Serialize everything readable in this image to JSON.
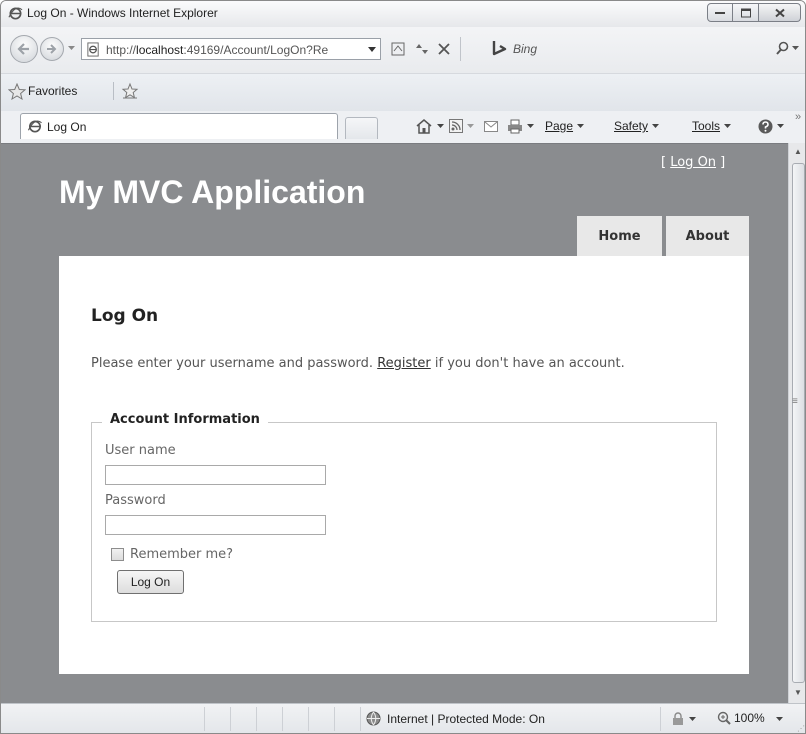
{
  "window": {
    "title": "Log On - Windows Internet Explorer"
  },
  "address_bar": {
    "url_prefix": "http://",
    "url_host": "localhost",
    "url_rest": ":49169/Account/LogOn?Re"
  },
  "search": {
    "placeholder": "Bing"
  },
  "favorites": {
    "label": "Favorites"
  },
  "tab": {
    "label": "Log On"
  },
  "command_bar": {
    "page": "Page",
    "safety": "Safety",
    "tools": "Tools"
  },
  "site": {
    "login_prefix": "[ ",
    "login_link": "Log On",
    "login_suffix": " ]",
    "title": "My MVC Application",
    "menu": [
      "Home",
      "About"
    ]
  },
  "main": {
    "heading": "Log On",
    "intro_before": "Please enter your username and password. ",
    "intro_link": "Register",
    "intro_after": " if you don't have an account.",
    "form": {
      "legend": "Account Information",
      "username_label": "User name",
      "username_value": "",
      "password_label": "Password",
      "password_value": "",
      "remember_label": "Remember me?",
      "remember_checked": false,
      "submit_label": "Log On"
    }
  },
  "status_bar": {
    "zone": "Internet | Protected Mode: On",
    "zoom": "100%"
  },
  "icons": {
    "title": "ie-logo-icon",
    "back": "back-arrow-icon",
    "forward": "forward-arrow-icon",
    "home": "home-icon",
    "feeds": "feeds-icon",
    "mail": "mail-icon",
    "print": "print-icon",
    "help": "help-icon"
  },
  "colors": {
    "site_background": "#8a8c8f",
    "content_background": "#ffffff",
    "menu_tab": "#e8e8e8"
  }
}
